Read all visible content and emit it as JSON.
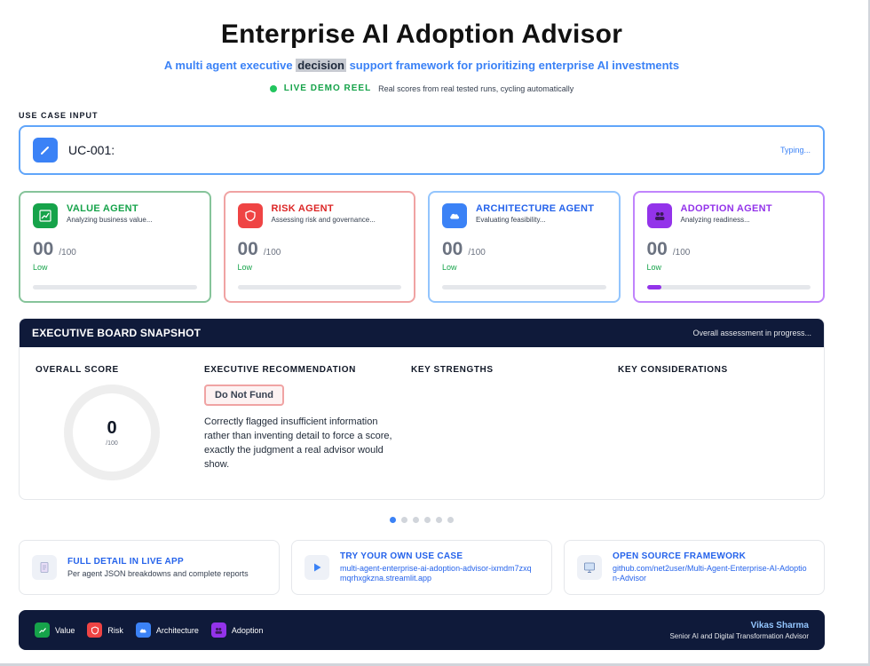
{
  "header": {
    "title": "Enterprise AI Adoption Advisor",
    "subtitle_before": "A multi agent executive ",
    "subtitle_highlight": "decision",
    "subtitle_after": " support framework for prioritizing enterprise AI investments",
    "demo_label": "LIVE DEMO REEL",
    "demo_desc": "Real scores from real tested runs, cycling automatically"
  },
  "use_case": {
    "section_label": "USE CASE INPUT",
    "id": "UC-001:",
    "status": "Typing..."
  },
  "agents": [
    {
      "name": "VALUE AGENT",
      "status": "Analyzing business value...",
      "score": "00",
      "max": "/100",
      "level": "Low",
      "progress": 0,
      "icon": "chart-icon"
    },
    {
      "name": "RISK AGENT",
      "status": "Assessing risk and governance...",
      "score": "00",
      "max": "/100",
      "level": "Low",
      "progress": 0,
      "icon": "shield-icon"
    },
    {
      "name": "ARCHITECTURE AGENT",
      "status": "Evaluating feasibility...",
      "score": "00",
      "max": "/100",
      "level": "Low",
      "progress": 0,
      "icon": "cloud-icon"
    },
    {
      "name": "ADOPTION AGENT",
      "status": "Analyzing readiness...",
      "score": "00",
      "max": "/100",
      "level": "Low",
      "progress": 0.09,
      "icon": "users-icon"
    }
  ],
  "board": {
    "title": "EXECUTIVE BOARD SNAPSHOT",
    "status": "Overall assessment in progress...",
    "overall_label": "OVERALL SCORE",
    "overall_value": "0",
    "overall_max": "/100",
    "recommendation_label": "EXECUTIVE RECOMMENDATION",
    "recommendation": "Do Not Fund",
    "recommendation_text": "Correctly flagged insufficient information rather than inventing detail to force a score, exactly the judgment a real advisor would show.",
    "strengths_label": "KEY STRENGTHS",
    "considerations_label": "KEY CONSIDERATIONS"
  },
  "carousel": {
    "count": 6,
    "active": 0
  },
  "links": [
    {
      "title": "FULL DETAIL IN LIVE APP",
      "desc": "Per agent JSON breakdowns and complete reports",
      "icon": "document-icon"
    },
    {
      "title": "TRY YOUR OWN USE CASE",
      "desc": "multi-agent-enterprise-ai-adoption-advisor-ixmdm7zxqmqrhxgkzna.streamlit.app",
      "icon": "play-icon"
    },
    {
      "title": "OPEN SOURCE FRAMEWORK",
      "desc": "github.com/net2user/Multi-Agent-Enterprise-AI-Adoption-Advisor",
      "icon": "monitor-icon"
    }
  ],
  "footer": {
    "legend": [
      {
        "label": "Value",
        "color": "#16a34a"
      },
      {
        "label": "Risk",
        "color": "#ef4444"
      },
      {
        "label": "Architecture",
        "color": "#3b82f6"
      },
      {
        "label": "Adoption",
        "color": "#9333ea"
      }
    ],
    "author_name": "Vikas Sharma",
    "author_role": "Senior AI and Digital Transformation Advisor"
  },
  "colors": {
    "accent": "#3b82f6",
    "navy": "#0f1a3a",
    "value": "#16a34a",
    "risk": "#ef4444",
    "architecture": "#3b82f6",
    "adoption": "#9333ea",
    "live": "#22c55e"
  }
}
